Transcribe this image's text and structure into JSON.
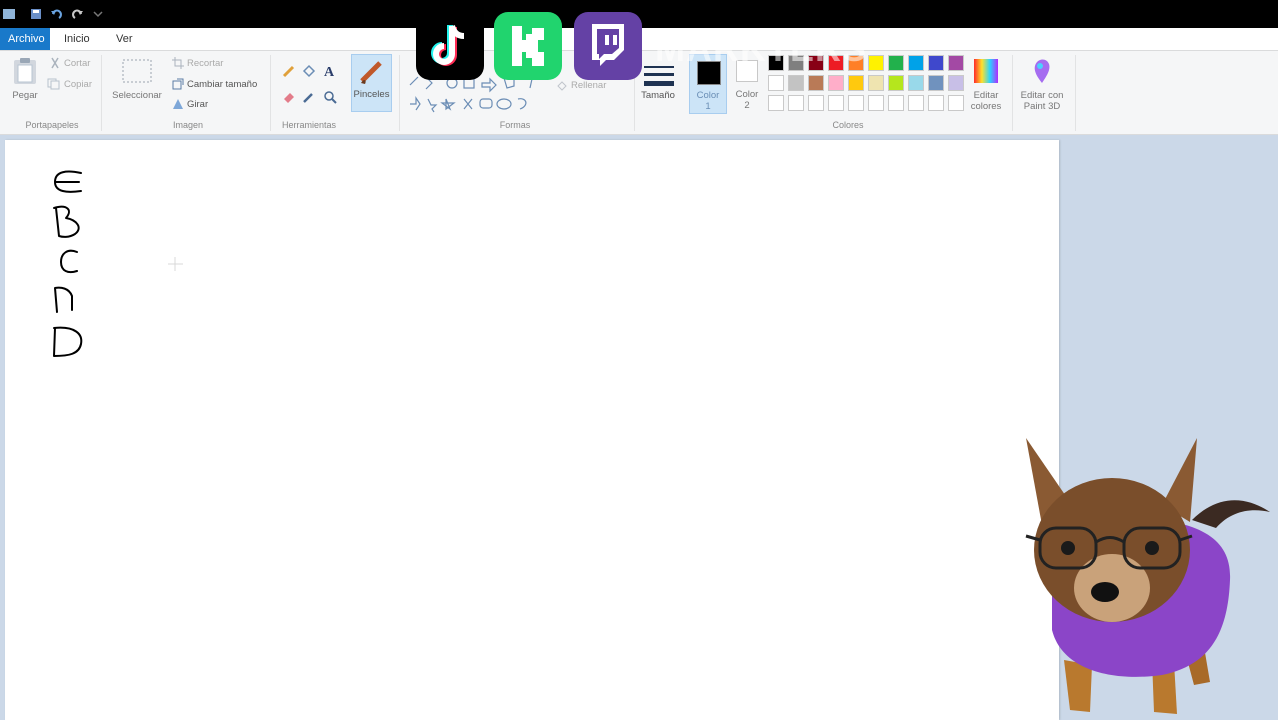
{
  "menu": {
    "file": "Archivo",
    "home": "Inicio",
    "view": "Ver"
  },
  "clipboard": {
    "paste": "Pegar",
    "cut": "Cortar",
    "copy": "Copiar",
    "group": "Portapapeles"
  },
  "image": {
    "select": "Seleccionar",
    "crop": "Recortar",
    "resize": "Cambiar tamaño",
    "rotate": "Girar",
    "group": "Imagen"
  },
  "tools": {
    "group": "Herramientas"
  },
  "brushes": {
    "label": "Pinceles"
  },
  "shapes": {
    "fill": "Rellenar",
    "group": "Formas"
  },
  "size": {
    "label": "Tamaño"
  },
  "color1": {
    "line1": "Color",
    "line2": "1"
  },
  "color2": {
    "line1": "Color",
    "line2": "2"
  },
  "colors": {
    "group": "Colores",
    "row1": [
      "#000000",
      "#7f7f7f",
      "#880015",
      "#ed1c24",
      "#ff7f27",
      "#fff200",
      "#22b14c",
      "#00a2e8",
      "#3f48cc",
      "#a349a4"
    ],
    "row2": [
      "#ffffff",
      "#c3c3c3",
      "#b97a57",
      "#ffaec9",
      "#ffc90e",
      "#efe4b0",
      "#b5e61d",
      "#99d9ea",
      "#7092be",
      "#c8bfe7"
    ]
  },
  "edit_colors": {
    "line1": "Editar",
    "line2": "colores"
  },
  "paint3d": {
    "line1": "Editar con",
    "line2": "Paint 3D"
  },
  "watermark": "MARKTERS",
  "canvas_letters": [
    "E",
    "B",
    "C",
    "A",
    "D"
  ]
}
